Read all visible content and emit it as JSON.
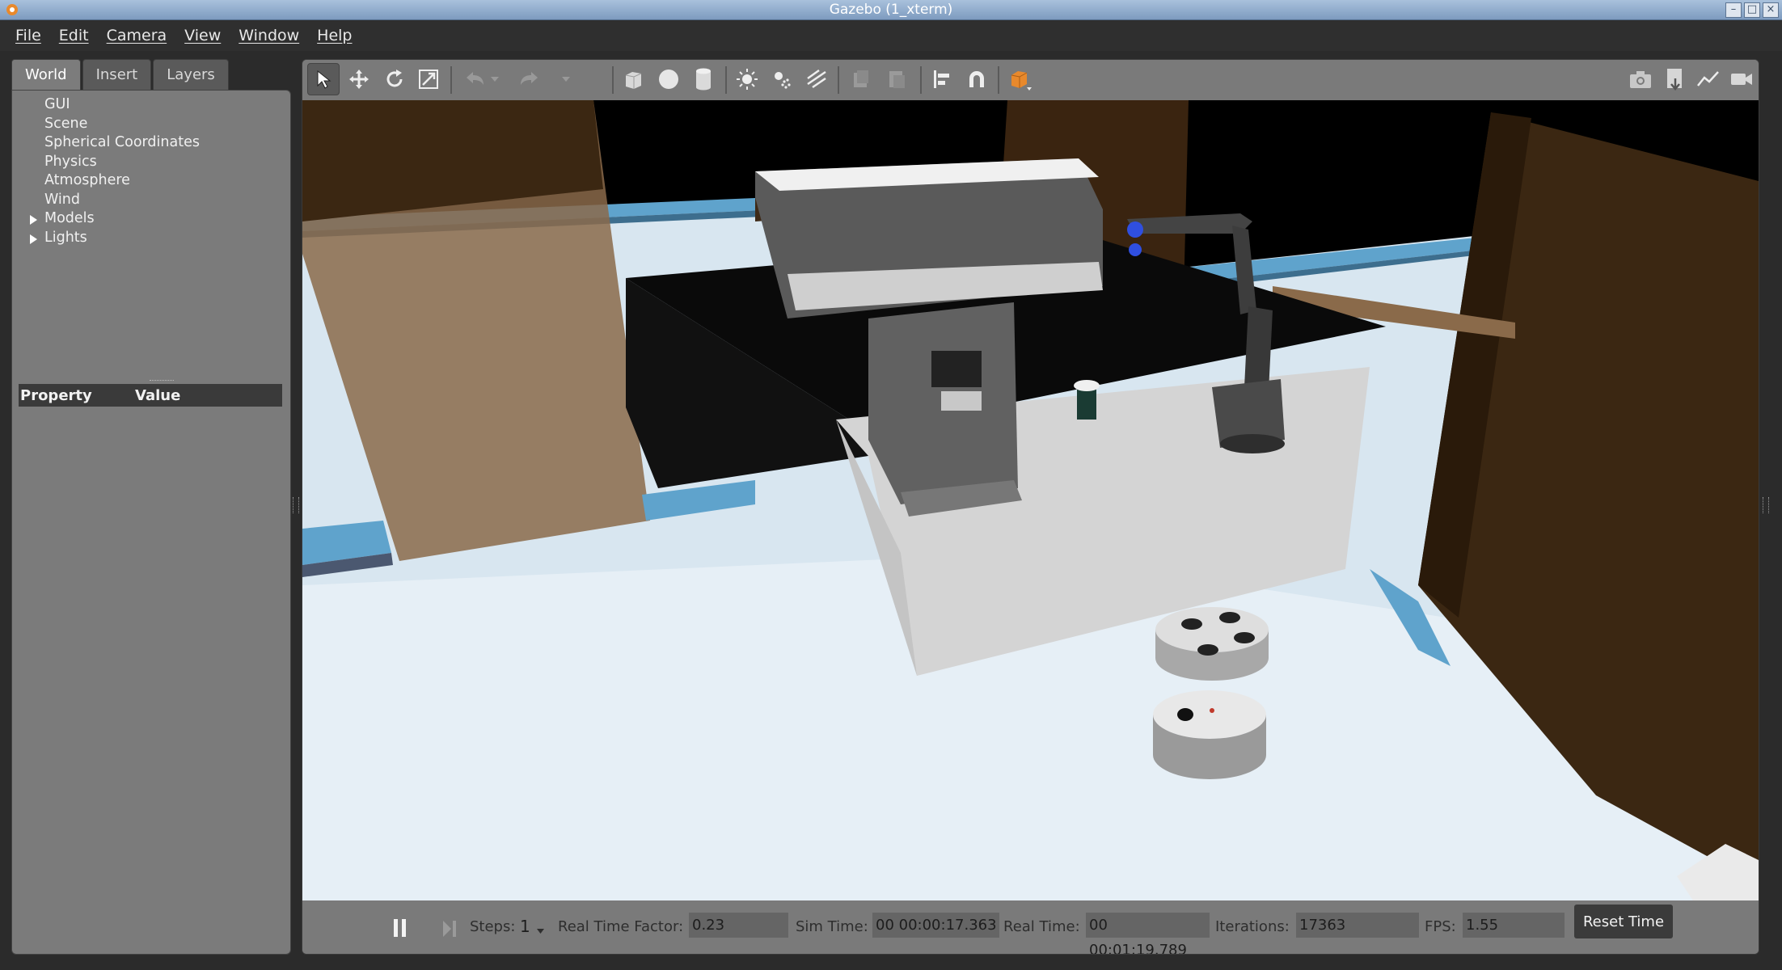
{
  "window": {
    "title": "Gazebo (1_xterm)"
  },
  "menubar": {
    "items": [
      "File",
      "Edit",
      "Camera",
      "View",
      "Window",
      "Help"
    ]
  },
  "left_panel": {
    "tabs": [
      "World",
      "Insert",
      "Layers"
    ],
    "active_tab": "World",
    "tree": [
      {
        "label": "GUI",
        "expandable": false
      },
      {
        "label": "Scene",
        "expandable": false
      },
      {
        "label": "Spherical Coordinates",
        "expandable": false
      },
      {
        "label": "Physics",
        "expandable": false
      },
      {
        "label": "Atmosphere",
        "expandable": false
      },
      {
        "label": "Wind",
        "expandable": false
      },
      {
        "label": "Models",
        "expandable": true
      },
      {
        "label": "Lights",
        "expandable": true
      }
    ],
    "property_header": {
      "property": "Property",
      "value": "Value"
    }
  },
  "toolbar": {
    "tools": [
      "select-arrow-icon",
      "translate-icon",
      "rotate-icon",
      "scale-icon",
      "undo-icon",
      "redo-icon",
      "box-icon",
      "sphere-icon",
      "cylinder-icon",
      "point-light-icon",
      "spot-light-icon",
      "directional-light-icon",
      "copy-icon",
      "paste-icon",
      "align-icon",
      "snap-magnet-icon",
      "view-angle-icon",
      "screenshot-icon",
      "log-icon",
      "plot-icon",
      "record-video-icon"
    ]
  },
  "bottom_bar": {
    "steps_label": "Steps:",
    "steps_value": "1",
    "rtf_label": "Real Time Factor:",
    "rtf_value": "0.23",
    "sim_time_label": "Sim Time:",
    "sim_time_value": "00 00:00:17.363",
    "real_time_label": "Real Time:",
    "real_time_value": "00 00:01:19.789",
    "iterations_label": "Iterations:",
    "iterations_value": "17363",
    "fps_label": "FPS:",
    "fps_value": "1.55",
    "reset_label": "Reset Time"
  },
  "colors": {
    "accent_orange": "#e8892c",
    "axis_blue": "#2f4fe0"
  }
}
